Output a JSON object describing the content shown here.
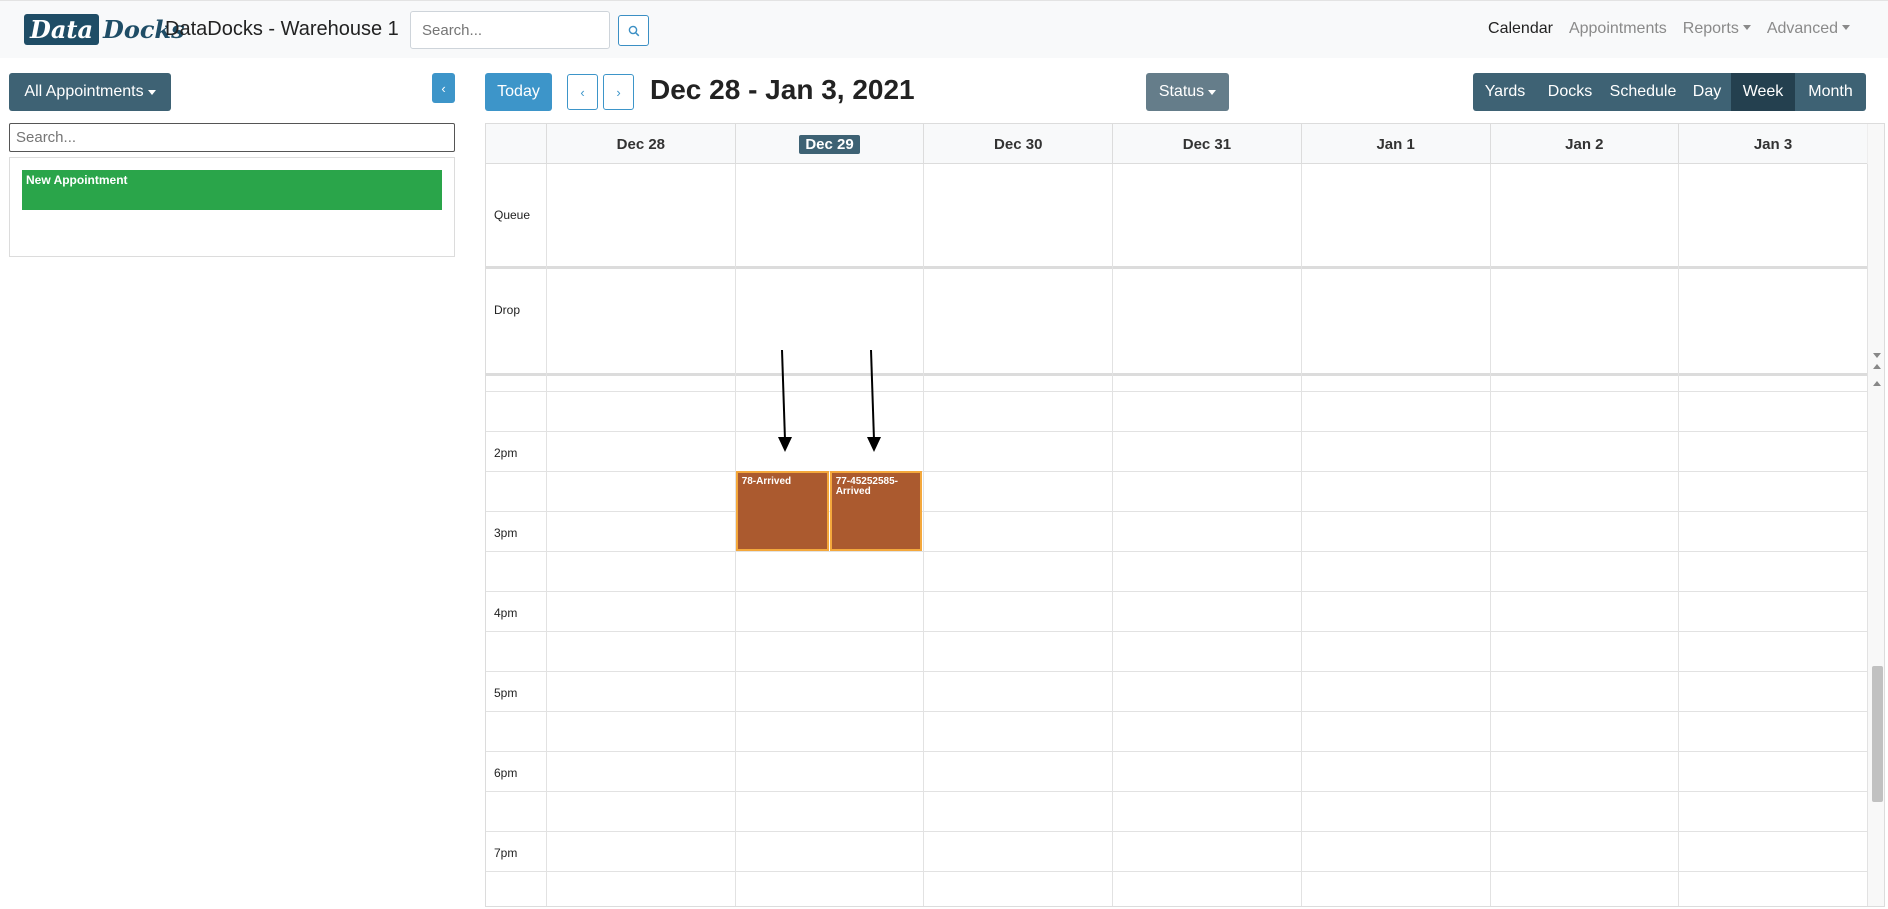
{
  "app": {
    "logo_part1": "Data",
    "logo_part2": "Docks",
    "title": "DataDocks - Warehouse 1",
    "search_placeholder": "Search..."
  },
  "nav": {
    "items": [
      {
        "label": "Calendar",
        "active": true,
        "dropdown": false
      },
      {
        "label": "Appointments",
        "active": false,
        "dropdown": false
      },
      {
        "label": "Reports",
        "active": false,
        "dropdown": true
      },
      {
        "label": "Advanced",
        "active": false,
        "dropdown": true
      }
    ]
  },
  "sidebar": {
    "filter_label": "All Appointments",
    "collapse_icon": "chevron-left-icon",
    "search_placeholder": "Search...",
    "items": [
      {
        "label": "New Appointment",
        "color": "#2aa54a"
      }
    ]
  },
  "toolbar": {
    "today_label": "Today",
    "range_title": "Dec 28 - Jan 3, 2021",
    "status_label": "Status",
    "views": [
      {
        "label": "Yards",
        "active": false
      },
      {
        "label": "Docks",
        "active": false
      },
      {
        "label": "Schedule",
        "active": false
      },
      {
        "label": "Day",
        "active": false
      },
      {
        "label": "Week",
        "active": true
      },
      {
        "label": "Month",
        "active": false
      }
    ]
  },
  "calendar": {
    "days": [
      {
        "label": "Dec 28",
        "today": false
      },
      {
        "label": "Dec 29",
        "today": true
      },
      {
        "label": "Dec 30",
        "today": false
      },
      {
        "label": "Dec 31",
        "today": false
      },
      {
        "label": "Jan 1",
        "today": false
      },
      {
        "label": "Jan 2",
        "today": false
      },
      {
        "label": "Jan 3",
        "today": false
      }
    ],
    "special_rows": [
      {
        "label": "Queue"
      },
      {
        "label": "Drop"
      }
    ],
    "time_labels": [
      "2pm",
      "3pm",
      "4pm",
      "5pm",
      "6pm",
      "7pm"
    ],
    "appointments": [
      {
        "label": "78-Arrived",
        "day": "Dec 29",
        "start": "2:30pm",
        "end": "3:30pm",
        "color": "#ab5a2f",
        "border_color": "#f4a83c"
      },
      {
        "label": "77-45252585-Arrived",
        "day": "Dec 29",
        "start": "2:30pm",
        "end": "3:30pm",
        "color": "#ab5a2f",
        "border_color": "#f4a83c"
      }
    ]
  }
}
